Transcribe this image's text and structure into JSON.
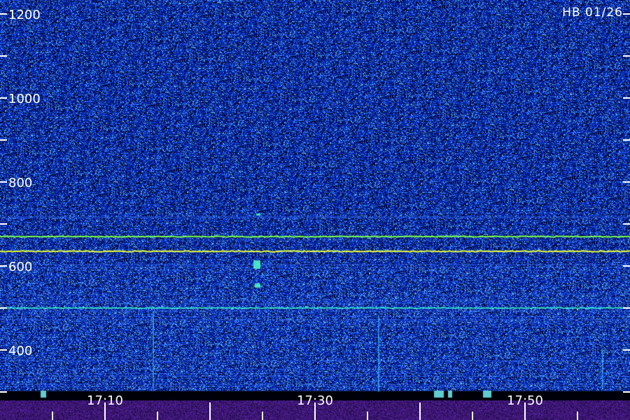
{
  "chart_data": {
    "type": "heatmap",
    "title": "",
    "xlabel": "",
    "ylabel": "",
    "corner_label": "HB 01/26",
    "x_range": [
      "17:03",
      "17:53"
    ],
    "y_range": [
      300,
      1230
    ],
    "x_ticks": [
      {
        "value": "17:10",
        "labeled": true
      },
      {
        "value": "17:30",
        "labeled": true
      },
      {
        "value": "17:50",
        "labeled": true
      }
    ],
    "y_ticks": [
      {
        "value": 1200,
        "label": "1200"
      },
      {
        "value": 1000,
        "label": "1000"
      },
      {
        "value": 800,
        "label": "800"
      },
      {
        "value": 600,
        "label": "600"
      },
      {
        "value": 400,
        "label": "400"
      }
    ],
    "signals": [
      {
        "freq": 670,
        "color": "#7cff4a",
        "strength": "strong"
      },
      {
        "freq": 635,
        "color": "#e8ff3a",
        "strength": "strong"
      },
      {
        "freq": 500,
        "color": "#3affd0",
        "strength": "medium"
      }
    ],
    "colors": {
      "background": "#0a0f7a",
      "noise_low": "#000010",
      "noise_high": "#1c4cff",
      "text": "#ffffff"
    }
  }
}
